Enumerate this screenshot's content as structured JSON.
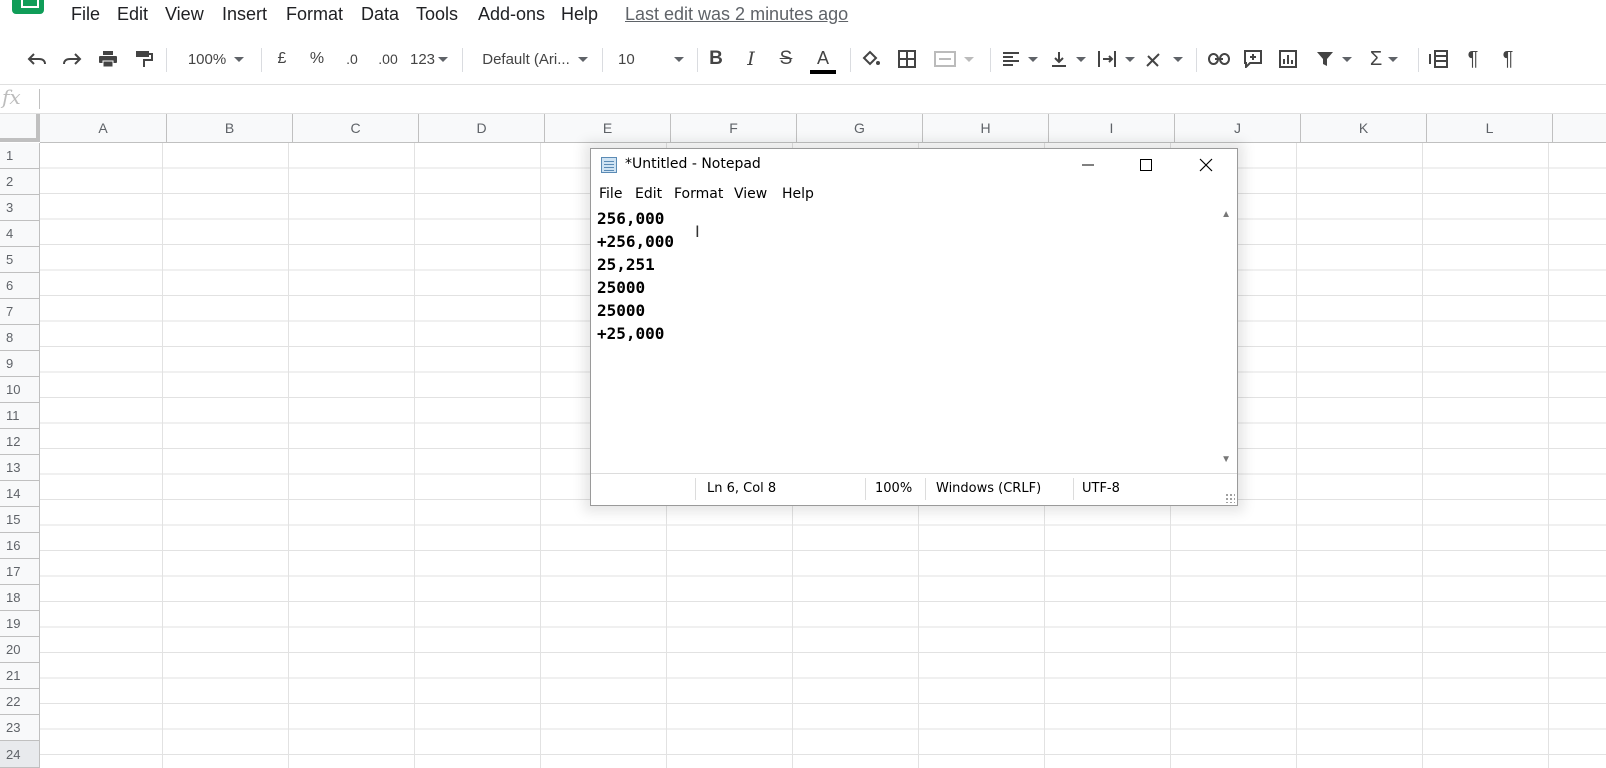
{
  "menu": {
    "items": [
      "File",
      "Edit",
      "View",
      "Insert",
      "Format",
      "Data",
      "Tools",
      "Add-ons",
      "Help"
    ],
    "last_edit": "Last edit was 2 minutes ago"
  },
  "toolbar": {
    "zoom": "100%",
    "currency": "£",
    "percent": "%",
    "decrease_decimal": ".0",
    "increase_decimal": ".00",
    "more_formats": "123",
    "font": "Default (Ari...",
    "font_size": "10"
  },
  "formula_bar": {
    "label": "fx",
    "value": ""
  },
  "grid": {
    "columns": [
      "A",
      "B",
      "C",
      "D",
      "E",
      "F",
      "G",
      "H",
      "I",
      "J",
      "K",
      "L"
    ],
    "rows": [
      "1",
      "2",
      "3",
      "4",
      "5",
      "6",
      "7",
      "8",
      "9",
      "10",
      "11",
      "12",
      "13",
      "14",
      "15",
      "16",
      "17",
      "18",
      "19",
      "20",
      "21",
      "22",
      "23",
      "24"
    ]
  },
  "notepad": {
    "title": "*Untitled - Notepad",
    "menu": [
      "File",
      "Edit",
      "Format",
      "View",
      "Help"
    ],
    "lines": [
      "256,000",
      "+256,000",
      "25,251",
      "25000",
      "25000",
      "+25,000"
    ],
    "status": {
      "position": "Ln 6, Col 8",
      "zoom": "100%",
      "line_ending": "Windows (CRLF)",
      "encoding": "UTF-8"
    }
  }
}
